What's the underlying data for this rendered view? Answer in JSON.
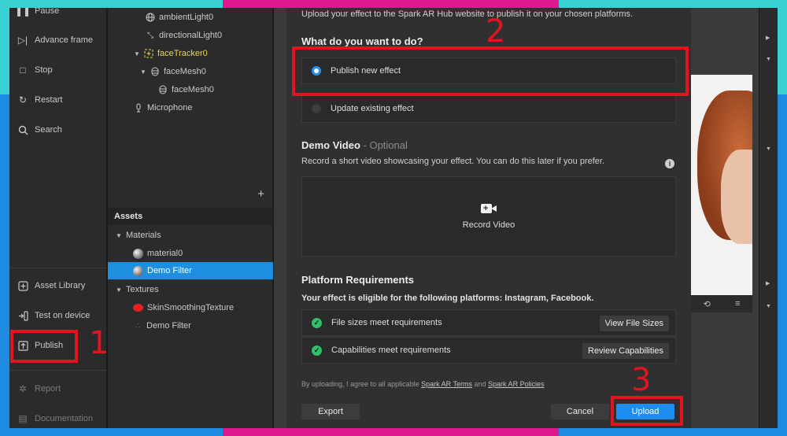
{
  "colors": {
    "frame_cyan": "#3ad1d4",
    "frame_magenta": "#e0178f",
    "frame_blue": "#1e8be0",
    "highlight_red": "#e0151f",
    "accent_blue": "#1f8cf0",
    "check_green": "#30c06b"
  },
  "left_toolbar": {
    "pause": "Pause",
    "advance_frame": "Advance frame",
    "stop": "Stop",
    "restart": "Restart",
    "search": "Search",
    "asset_library": "Asset Library",
    "test_on_device": "Test on device",
    "publish": "Publish",
    "report": "Report",
    "documentation": "Documentation"
  },
  "scene_tree": {
    "items": [
      {
        "label": "ambientLight0",
        "icon": "globe-icon"
      },
      {
        "label": "directionalLight0",
        "icon": "directional-light-icon"
      },
      {
        "label": "faceTracker0",
        "icon": "face-tracker-icon"
      },
      {
        "label": "faceMesh0",
        "icon": "mesh-icon"
      },
      {
        "label": "faceMesh0",
        "icon": "mesh-icon"
      },
      {
        "label": "Microphone",
        "icon": "microphone-icon"
      }
    ],
    "add_symbol": "+"
  },
  "assets": {
    "header": "Assets",
    "materials_label": "Materials",
    "materials": [
      "material0",
      "Demo Filter"
    ],
    "textures_label": "Textures",
    "textures": [
      "SkinSmoothingTexture",
      "Demo Filter"
    ]
  },
  "dialog": {
    "intro": "Upload your effect to the Spark AR Hub website to publish it on your chosen platforms.",
    "question": "What do you want to do?",
    "options": [
      {
        "label": "Publish new effect",
        "selected": true
      },
      {
        "label": "Update existing effect",
        "selected": false
      }
    ],
    "demo_video": {
      "title": "Demo Video",
      "optional": "- Optional",
      "description": "Record a short video showcasing your effect. You can do this later if you prefer.",
      "record_label": "Record Video"
    },
    "platform": {
      "title": "Platform Requirements",
      "description": "Your effect is eligible for the following platforms: Instagram, Facebook.",
      "requirements": [
        {
          "label": "File sizes meet requirements",
          "button": "View File Sizes"
        },
        {
          "label": "Capabilities meet requirements",
          "button": "Review Capabilities"
        }
      ]
    },
    "terms": {
      "prefix": "By uploading, I agree to all applicable",
      "terms_link": "Spark AR Terms",
      "and": "and",
      "policies_link": "Spark AR Policies"
    },
    "export_label": "Export",
    "cancel_label": "Cancel",
    "upload_label": "Upload"
  },
  "annotations": {
    "step1": "1",
    "step2": "2",
    "step3": "3"
  }
}
